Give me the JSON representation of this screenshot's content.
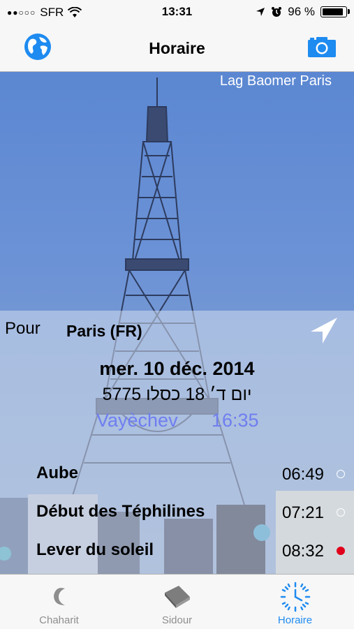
{
  "status_bar": {
    "carrier": "SFR",
    "time": "13:31",
    "battery": "96 %",
    "battery_level": 0.96,
    "signal_icon": "signal-dots-icon",
    "wifi_icon": "wifi-icon"
  },
  "nav": {
    "title": "Horaire",
    "left_icon": "globe-icon",
    "right_icon": "camera-icon"
  },
  "photo": {
    "caption": "Lag Baomer Paris"
  },
  "location": {
    "prefix": "Pour",
    "city": "Paris (FR)",
    "icon": "location-arrow-icon"
  },
  "day": {
    "date": "mer. 10 déc. 2014",
    "hebrew_date": "יום ד׳ 18 כסלו 5775",
    "parasha": "Vayèchev",
    "candle_time": "16:35"
  },
  "times": [
    {
      "label": "Aube",
      "time": "06:49",
      "active": false
    },
    {
      "label": "Début des Téphilines",
      "time": "07:21",
      "active": false
    },
    {
      "label": "Lever du soleil",
      "time": "08:32",
      "active": true
    }
  ],
  "tabs": [
    {
      "label": "Chaharit",
      "icon": "moon-icon",
      "active": false
    },
    {
      "label": "Sidour",
      "icon": "book-icon",
      "active": false
    },
    {
      "label": "Horaire",
      "icon": "clock-icon",
      "active": true
    }
  ],
  "colors": {
    "accent": "#1e8bf0",
    "parasha": "#6f7ef0",
    "active_dot": "#e0001b"
  }
}
